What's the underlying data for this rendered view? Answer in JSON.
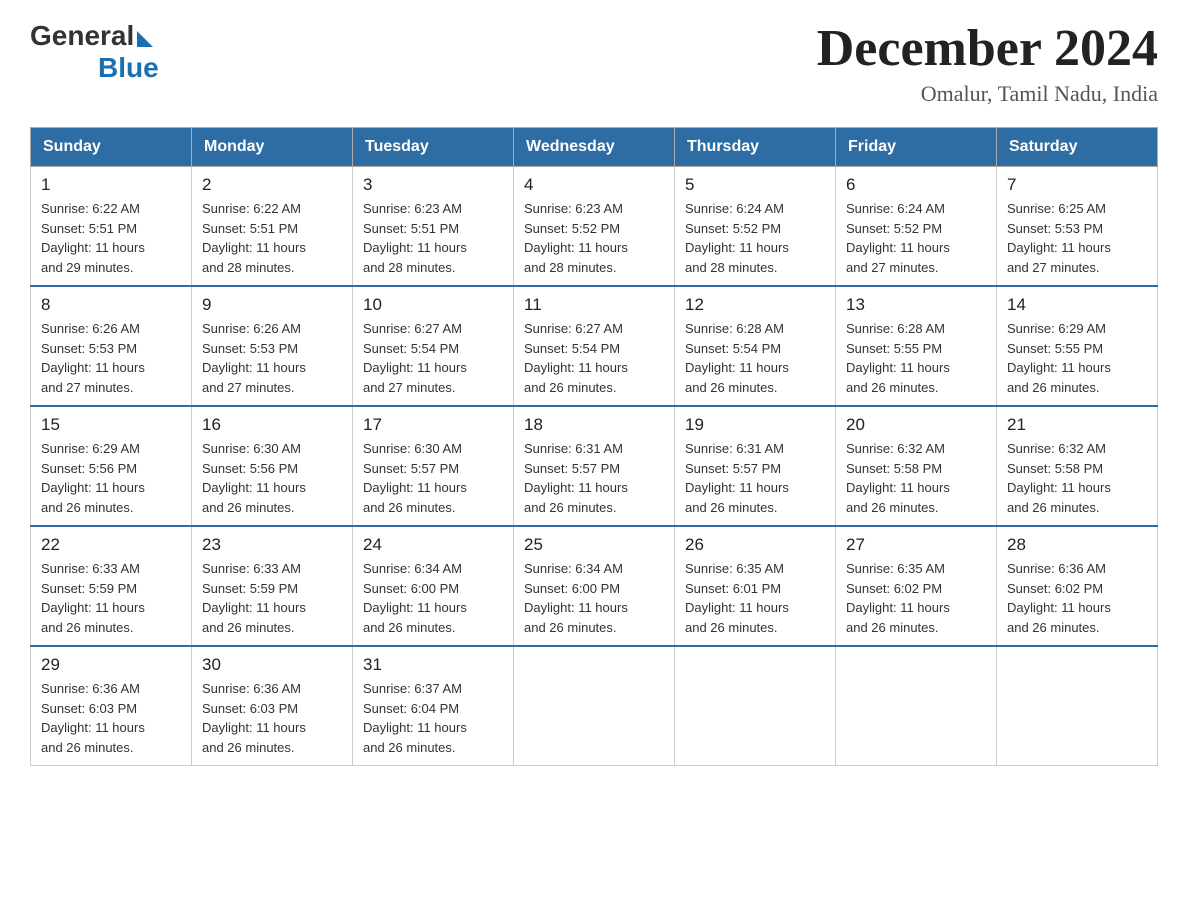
{
  "header": {
    "logo_general": "General",
    "logo_blue": "Blue",
    "main_title": "December 2024",
    "subtitle": "Omalur, Tamil Nadu, India"
  },
  "days_of_week": [
    "Sunday",
    "Monday",
    "Tuesday",
    "Wednesday",
    "Thursday",
    "Friday",
    "Saturday"
  ],
  "weeks": [
    [
      {
        "day": "1",
        "sunrise": "6:22 AM",
        "sunset": "5:51 PM",
        "daylight": "11 hours and 29 minutes."
      },
      {
        "day": "2",
        "sunrise": "6:22 AM",
        "sunset": "5:51 PM",
        "daylight": "11 hours and 28 minutes."
      },
      {
        "day": "3",
        "sunrise": "6:23 AM",
        "sunset": "5:51 PM",
        "daylight": "11 hours and 28 minutes."
      },
      {
        "day": "4",
        "sunrise": "6:23 AM",
        "sunset": "5:52 PM",
        "daylight": "11 hours and 28 minutes."
      },
      {
        "day": "5",
        "sunrise": "6:24 AM",
        "sunset": "5:52 PM",
        "daylight": "11 hours and 28 minutes."
      },
      {
        "day": "6",
        "sunrise": "6:24 AM",
        "sunset": "5:52 PM",
        "daylight": "11 hours and 27 minutes."
      },
      {
        "day": "7",
        "sunrise": "6:25 AM",
        "sunset": "5:53 PM",
        "daylight": "11 hours and 27 minutes."
      }
    ],
    [
      {
        "day": "8",
        "sunrise": "6:26 AM",
        "sunset": "5:53 PM",
        "daylight": "11 hours and 27 minutes."
      },
      {
        "day": "9",
        "sunrise": "6:26 AM",
        "sunset": "5:53 PM",
        "daylight": "11 hours and 27 minutes."
      },
      {
        "day": "10",
        "sunrise": "6:27 AM",
        "sunset": "5:54 PM",
        "daylight": "11 hours and 27 minutes."
      },
      {
        "day": "11",
        "sunrise": "6:27 AM",
        "sunset": "5:54 PM",
        "daylight": "11 hours and 26 minutes."
      },
      {
        "day": "12",
        "sunrise": "6:28 AM",
        "sunset": "5:54 PM",
        "daylight": "11 hours and 26 minutes."
      },
      {
        "day": "13",
        "sunrise": "6:28 AM",
        "sunset": "5:55 PM",
        "daylight": "11 hours and 26 minutes."
      },
      {
        "day": "14",
        "sunrise": "6:29 AM",
        "sunset": "5:55 PM",
        "daylight": "11 hours and 26 minutes."
      }
    ],
    [
      {
        "day": "15",
        "sunrise": "6:29 AM",
        "sunset": "5:56 PM",
        "daylight": "11 hours and 26 minutes."
      },
      {
        "day": "16",
        "sunrise": "6:30 AM",
        "sunset": "5:56 PM",
        "daylight": "11 hours and 26 minutes."
      },
      {
        "day": "17",
        "sunrise": "6:30 AM",
        "sunset": "5:57 PM",
        "daylight": "11 hours and 26 minutes."
      },
      {
        "day": "18",
        "sunrise": "6:31 AM",
        "sunset": "5:57 PM",
        "daylight": "11 hours and 26 minutes."
      },
      {
        "day": "19",
        "sunrise": "6:31 AM",
        "sunset": "5:57 PM",
        "daylight": "11 hours and 26 minutes."
      },
      {
        "day": "20",
        "sunrise": "6:32 AM",
        "sunset": "5:58 PM",
        "daylight": "11 hours and 26 minutes."
      },
      {
        "day": "21",
        "sunrise": "6:32 AM",
        "sunset": "5:58 PM",
        "daylight": "11 hours and 26 minutes."
      }
    ],
    [
      {
        "day": "22",
        "sunrise": "6:33 AM",
        "sunset": "5:59 PM",
        "daylight": "11 hours and 26 minutes."
      },
      {
        "day": "23",
        "sunrise": "6:33 AM",
        "sunset": "5:59 PM",
        "daylight": "11 hours and 26 minutes."
      },
      {
        "day": "24",
        "sunrise": "6:34 AM",
        "sunset": "6:00 PM",
        "daylight": "11 hours and 26 minutes."
      },
      {
        "day": "25",
        "sunrise": "6:34 AM",
        "sunset": "6:00 PM",
        "daylight": "11 hours and 26 minutes."
      },
      {
        "day": "26",
        "sunrise": "6:35 AM",
        "sunset": "6:01 PM",
        "daylight": "11 hours and 26 minutes."
      },
      {
        "day": "27",
        "sunrise": "6:35 AM",
        "sunset": "6:02 PM",
        "daylight": "11 hours and 26 minutes."
      },
      {
        "day": "28",
        "sunrise": "6:36 AM",
        "sunset": "6:02 PM",
        "daylight": "11 hours and 26 minutes."
      }
    ],
    [
      {
        "day": "29",
        "sunrise": "6:36 AM",
        "sunset": "6:03 PM",
        "daylight": "11 hours and 26 minutes."
      },
      {
        "day": "30",
        "sunrise": "6:36 AM",
        "sunset": "6:03 PM",
        "daylight": "11 hours and 26 minutes."
      },
      {
        "day": "31",
        "sunrise": "6:37 AM",
        "sunset": "6:04 PM",
        "daylight": "11 hours and 26 minutes."
      },
      null,
      null,
      null,
      null
    ]
  ],
  "labels": {
    "sunrise": "Sunrise: ",
    "sunset": "Sunset: ",
    "daylight": "Daylight: "
  }
}
